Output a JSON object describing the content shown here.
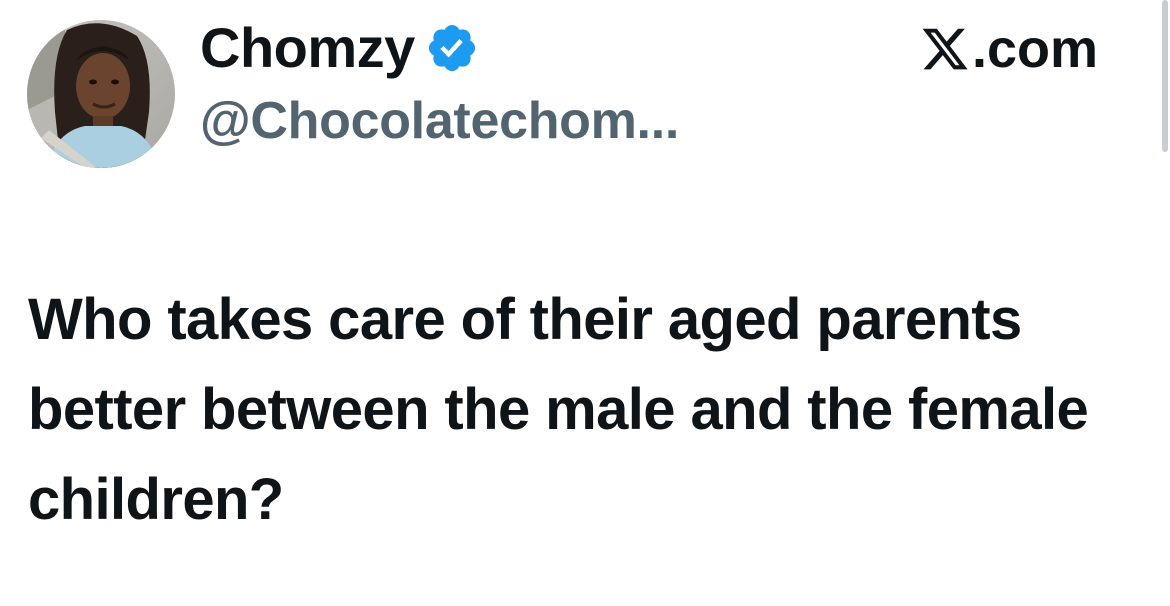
{
  "tweet": {
    "author": {
      "display_name": "Chomzy",
      "handle": "@Chocolatechom...",
      "verified": true,
      "verified_icon": "verified-badge-icon",
      "avatar": "profile-photo"
    },
    "brand": {
      "icon": "x-logo-icon",
      "text": ".com"
    },
    "text": "Who takes care of their aged parents better between the male and the female children?"
  },
  "colors": {
    "text_primary": "#0f1419",
    "text_secondary": "#536471",
    "verified_blue": "#1d9bf0",
    "background": "#ffffff"
  }
}
